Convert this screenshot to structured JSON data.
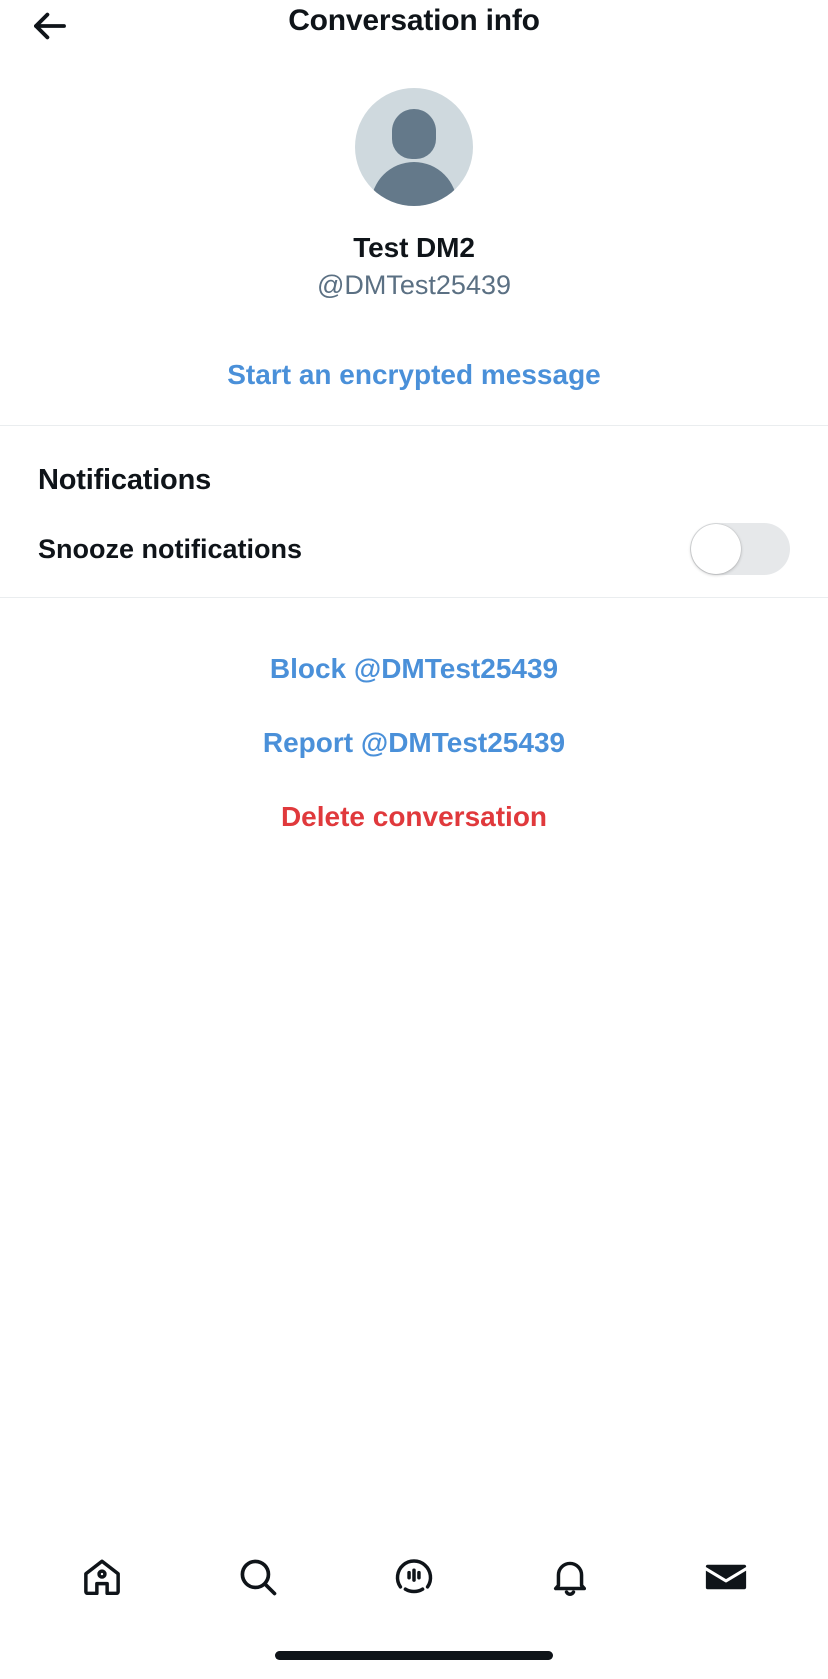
{
  "header": {
    "title": "Conversation info",
    "back_icon": "arrow-left-icon"
  },
  "profile": {
    "avatar_icon": "default-avatar-person-icon",
    "display_name": "Test DM2",
    "handle": "@DMTest25439",
    "encrypted_link_label": "Start an encrypted message"
  },
  "notifications": {
    "section_title": "Notifications",
    "snooze": {
      "label": "Snooze notifications",
      "state": "off"
    }
  },
  "actions": [
    {
      "label": "Block @DMTest25439",
      "style": "blue",
      "name": "block-user-link"
    },
    {
      "label": "Report @DMTest25439",
      "style": "blue",
      "name": "report-user-link"
    },
    {
      "label": "Delete conversation",
      "style": "red",
      "name": "delete-conversation-link"
    }
  ],
  "bottom_nav": [
    {
      "icon": "home-icon",
      "name": "nav-home",
      "active": false
    },
    {
      "icon": "search-icon",
      "name": "nav-search",
      "active": false
    },
    {
      "icon": "spaces-icon",
      "name": "nav-spaces",
      "active": false
    },
    {
      "icon": "bell-icon",
      "name": "nav-notifications",
      "active": false
    },
    {
      "icon": "envelope-icon",
      "name": "nav-messages",
      "active": true
    }
  ],
  "colors": {
    "accent_blue": "#4a90d9",
    "danger_red": "#e0393c",
    "text_primary": "#0f1419",
    "text_secondary": "#5b7083",
    "toggle_off_track": "#e6e8ea",
    "avatar_bg": "#cfd9de",
    "avatar_fg": "#64798a"
  }
}
